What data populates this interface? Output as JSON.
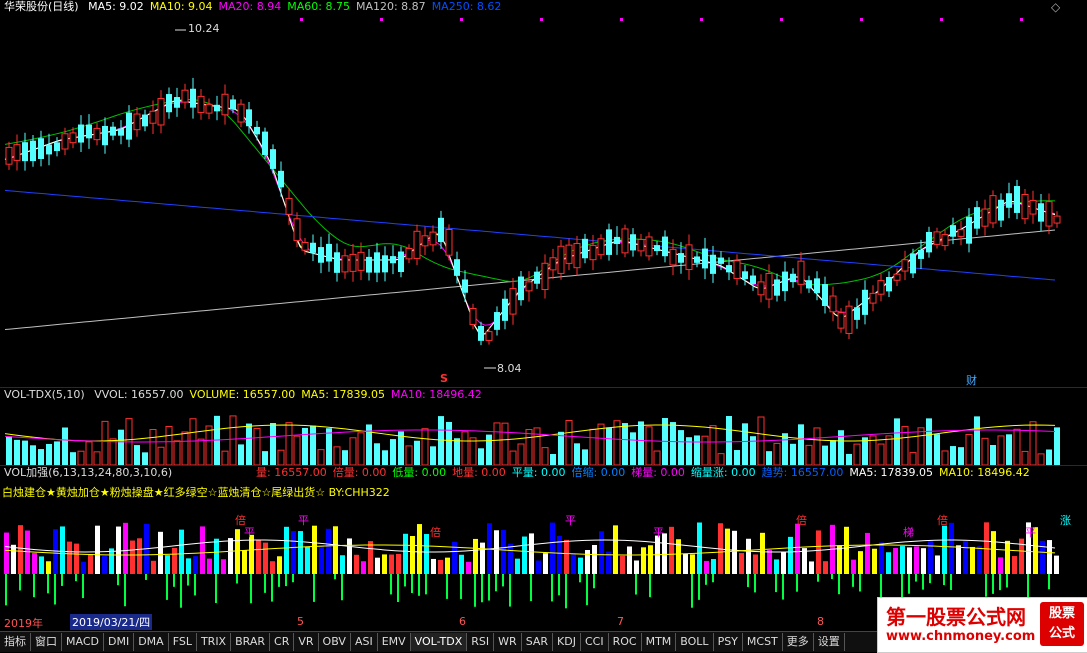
{
  "main": {
    "stock_name": "华荣股份",
    "period": "(日线)",
    "ma_labels": [
      {
        "text": "MA5: 9.02",
        "color": "#ffffff"
      },
      {
        "text": "MA10: 9.04",
        "color": "#ffff00"
      },
      {
        "text": "MA20: 8.94",
        "color": "#ff00ff"
      },
      {
        "text": "MA60: 8.75",
        "color": "#00ff00"
      },
      {
        "text": "MA120: 8.87",
        "color": "#c0c0c0"
      },
      {
        "text": "MA250: 8.62",
        "color": "#0050ff"
      }
    ],
    "high_label": "10.24",
    "low_label": "8.04",
    "marker_s": "S",
    "marker_cai": "财",
    "diamond": "◇"
  },
  "vol": {
    "name": "VOL-TDX(5,10)",
    "labels": [
      {
        "text": "VVOL: 16557.00",
        "color": "#dddddd"
      },
      {
        "text": "VOLUME: 16557.00",
        "color": "#ffff00"
      },
      {
        "text": "MA5: 17839.05",
        "color": "#ffff00"
      },
      {
        "text": "MA10: 18496.42",
        "color": "#ff00ff"
      }
    ]
  },
  "volplus": {
    "name": "VOL加强(6,13,13,24,80,3,10,6)",
    "labels": [
      {
        "text": "量: 16557.00",
        "color": "#ff3030"
      },
      {
        "text": "倍量: 0.00",
        "color": "#ff3030"
      },
      {
        "text": "低量: 0.00",
        "color": "#00ff00"
      },
      {
        "text": "地量: 0.00",
        "color": "#ff3030"
      },
      {
        "text": "平量: 0.00",
        "color": "#00ffff"
      },
      {
        "text": "倍缩: 0.00",
        "color": "#0080ff"
      },
      {
        "text": "梯量: 0.00",
        "color": "#ff00ff"
      },
      {
        "text": "缩量涨: 0.00",
        "color": "#00ffff"
      },
      {
        "text": "趋势: 16557.00",
        "color": "#0060ff"
      },
      {
        "text": "MA5: 17839.05",
        "color": "#ffffff"
      },
      {
        "text": "MA10: 18496.42",
        "color": "#ffff00"
      }
    ],
    "legend": "白烛建仓★黄烛加仓★粉烛操盘★红多绿空☆蓝烛清仓☆尾绿出货☆ BY:CHH322",
    "chart_marks": [
      "倍",
      "平",
      "梯",
      "涨"
    ]
  },
  "dates": {
    "year": "2019年",
    "cursor": "2019/03/21/四",
    "months": [
      "5",
      "6",
      "7",
      "8"
    ]
  },
  "tabs": [
    "指标",
    "窗口",
    "MACD",
    "DMI",
    "DMA",
    "FSL",
    "TRIX",
    "BRAR",
    "CR",
    "VR",
    "OBV",
    "ASI",
    "EMV",
    "VOL-TDX",
    "RSI",
    "WR",
    "SAR",
    "KDJ",
    "CCI",
    "ROC",
    "MTM",
    "BOLL",
    "PSY",
    "MCST",
    "更多",
    "设置"
  ],
  "watermark": {
    "title": "第一股票公式网",
    "url": "www.chnmoney.com",
    "logo1": "股票",
    "logo2": "公式"
  }
}
